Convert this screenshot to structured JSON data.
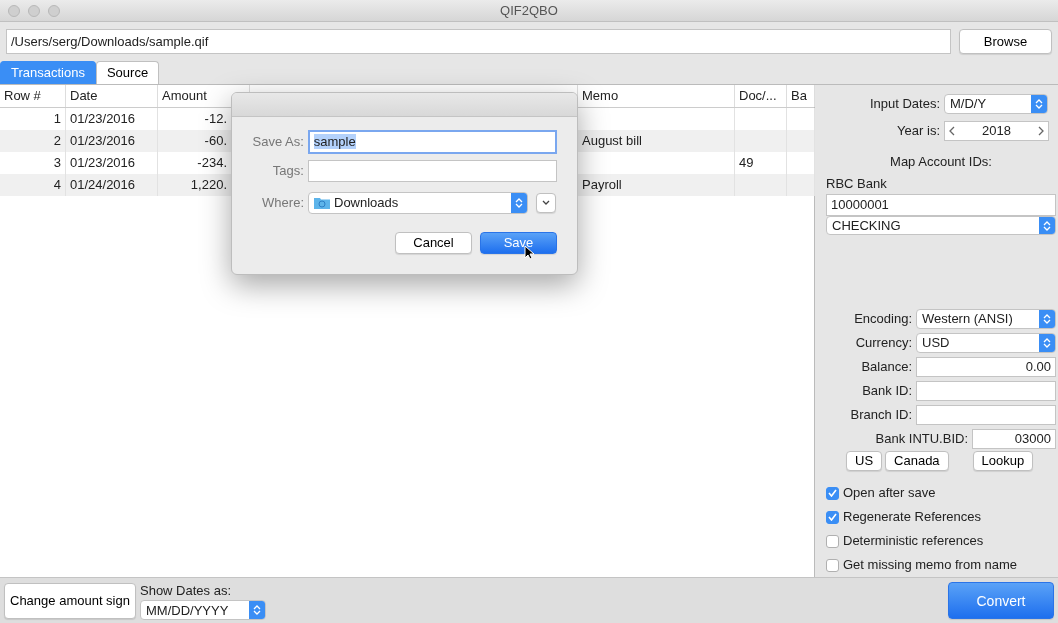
{
  "window": {
    "title": "QIF2QBO"
  },
  "file_path": {
    "value": "/Users/serg/Downloads/sample.qif"
  },
  "browse_button": "Browse",
  "tabs": [
    {
      "label": "Transactions",
      "selected": true
    },
    {
      "label": "Source",
      "selected": false
    }
  ],
  "table": {
    "columns": [
      "Row #",
      "Date",
      "Amount",
      "Memo",
      "Doc/...",
      "Ba"
    ],
    "rows": [
      [
        "1",
        "01/23/2016",
        "-12.",
        null,
        null,
        null
      ],
      [
        "2",
        "01/23/2016",
        "-60.",
        "August bill",
        null,
        null
      ],
      [
        "3",
        "01/23/2016",
        "-234.",
        null,
        "49",
        null
      ],
      [
        "4",
        "01/24/2016",
        "1,220.",
        "Payroll",
        null,
        null
      ]
    ]
  },
  "save_dialog": {
    "save_as": {
      "label": "Save As:",
      "value": "sample"
    },
    "tags": {
      "label": "Tags:"
    },
    "where": {
      "label": "Where:",
      "value": "Downloads"
    },
    "buttons": [
      {
        "label": "Cancel",
        "default": false
      },
      {
        "label": "Save",
        "default": true
      }
    ]
  },
  "side_panel": {
    "input_dates": {
      "label": "Input Dates:",
      "value": "M/D/Y"
    },
    "year": {
      "label": "Year is:",
      "value": "2018"
    },
    "map_heading": "Map Account IDs:",
    "account": {
      "name": "RBC Bank",
      "id": "10000001",
      "type": "CHECKING"
    },
    "fields": [
      {
        "kind": "select",
        "label": "Encoding:",
        "value": "Western (ANSI)"
      },
      {
        "kind": "select",
        "label": "Currency:",
        "value": "USD"
      },
      {
        "kind": "input",
        "label": "Balance:",
        "value": "0.00"
      },
      {
        "kind": "input",
        "label": "Bank ID:"
      },
      {
        "kind": "input",
        "label": "Branch ID:"
      },
      {
        "kind": "short_input",
        "label": "Bank INTU.BID:",
        "value": "03000"
      }
    ],
    "buttons": [
      "US",
      "Canada",
      "Lookup"
    ],
    "options": [
      {
        "label": "Open after save",
        "checked": true
      },
      {
        "label": "Regenerate References",
        "checked": true
      },
      {
        "label": "Deterministic references",
        "checked": false
      },
      {
        "label": "Get missing memo from name",
        "checked": false
      }
    ],
    "convert_button": "Convert"
  },
  "bottom_bar": {
    "change_sign_button": "Change amount sign",
    "show_dates": {
      "label": "Show Dates as:",
      "value": "MM/DD/YYYY"
    }
  }
}
